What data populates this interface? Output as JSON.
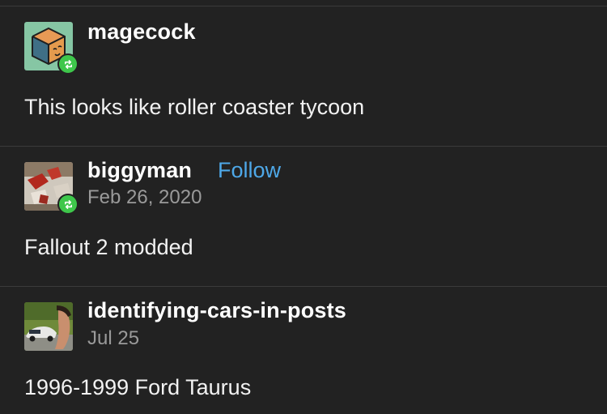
{
  "colors": {
    "background": "#222222",
    "divider": "#3b3b3b",
    "follow": "#4ea8e8",
    "date": "#9a9a9a",
    "reblog_badge": "#3ec74b"
  },
  "posts": [
    {
      "username": "magecock",
      "avatar_icon": "cube-face-avatar-icon",
      "reblog": true,
      "text": "This looks like roller coaster tycoon"
    },
    {
      "username": "biggyman",
      "follow_label": "Follow",
      "date": "Feb 26, 2020",
      "avatar_icon": "game-screenshot-avatar-icon",
      "reblog": true,
      "text": "Fallout 2 modded"
    },
    {
      "username": "identifying-cars-in-posts",
      "date": "Jul 25",
      "avatar_icon": "car-photo-avatar-icon",
      "text": "1996-1999 Ford Taurus"
    }
  ]
}
